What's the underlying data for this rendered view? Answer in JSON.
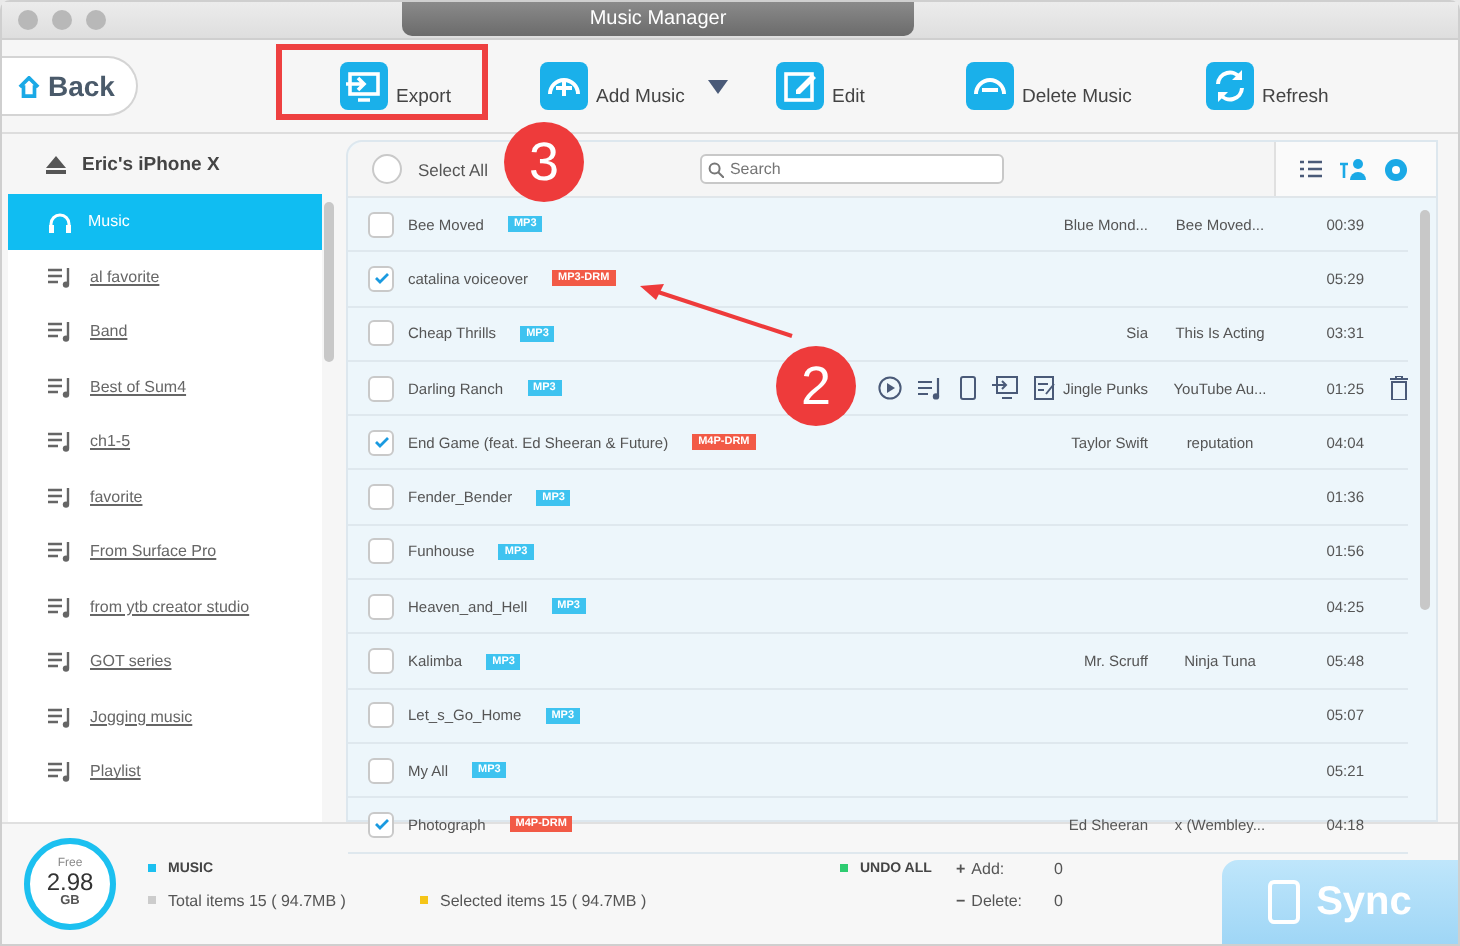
{
  "window": {
    "title": "Music Manager"
  },
  "back_button": "Back",
  "toolbar": [
    {
      "kind": "export",
      "label": "Export",
      "dropdown": false
    },
    {
      "kind": "add",
      "label": "Add Music",
      "dropdown": true
    },
    {
      "kind": "edit",
      "label": "Edit",
      "dropdown": false
    },
    {
      "kind": "delete",
      "label": "Delete Music",
      "dropdown": false
    },
    {
      "kind": "refresh",
      "label": "Refresh",
      "dropdown": false
    }
  ],
  "sidebar": {
    "device": "Eric's iPhone X",
    "items": [
      {
        "kind": "music",
        "label": "Music",
        "selected": true
      },
      {
        "kind": "playlist",
        "label": "al favorite",
        "selected": false
      },
      {
        "kind": "playlist",
        "label": "Band",
        "selected": false
      },
      {
        "kind": "playlist",
        "label": "Best of Sum4",
        "selected": false
      },
      {
        "kind": "playlist",
        "label": "ch1-5",
        "selected": false
      },
      {
        "kind": "playlist",
        "label": "favorite",
        "selected": false
      },
      {
        "kind": "playlist",
        "label": "From Surface Pro",
        "selected": false
      },
      {
        "kind": "playlist",
        "label": "from ytb creator studio",
        "selected": false
      },
      {
        "kind": "playlist",
        "label": "GOT series",
        "selected": false
      },
      {
        "kind": "playlist",
        "label": "Jogging music",
        "selected": false
      },
      {
        "kind": "playlist",
        "label": "Playlist",
        "selected": false
      }
    ]
  },
  "list_header": {
    "select_all": "Select All",
    "select_all_checked": false,
    "search_placeholder": "Search"
  },
  "tracks": [
    {
      "name": "Bee Moved",
      "tag": "MP3",
      "drm": false,
      "artist": "Blue Mond...",
      "album": "Bee Moved...",
      "time": "00:39",
      "checked": false,
      "hovered": false
    },
    {
      "name": "catalina voiceover",
      "tag": "MP3-DRM",
      "drm": true,
      "time": "05:29",
      "checked": true,
      "hovered": false
    },
    {
      "name": "Cheap Thrills",
      "tag": "MP3",
      "drm": false,
      "artist": "Sia",
      "album": "This Is Acting",
      "time": "03:31",
      "checked": false,
      "hovered": false
    },
    {
      "name": "Darling Ranch",
      "tag": "MP3",
      "drm": false,
      "artist": "Jingle Punks",
      "album": "YouTube Au...",
      "time": "01:25",
      "checked": false,
      "hovered": true
    },
    {
      "name": "End Game (feat. Ed Sheeran & Future)",
      "tag": "M4P-DRM",
      "drm": true,
      "artist": "Taylor Swift",
      "album": "reputation",
      "time": "04:04",
      "checked": true,
      "hovered": false
    },
    {
      "name": "Fender_Bender",
      "tag": "MP3",
      "drm": false,
      "time": "01:36",
      "checked": false,
      "hovered": false
    },
    {
      "name": "Funhouse",
      "tag": "MP3",
      "drm": false,
      "time": "01:56",
      "checked": false,
      "hovered": false
    },
    {
      "name": "Heaven_and_Hell",
      "tag": "MP3",
      "drm": false,
      "time": "04:25",
      "checked": false,
      "hovered": false
    },
    {
      "name": "Kalimba",
      "tag": "MP3",
      "drm": false,
      "artist": "Mr. Scruff",
      "album": "Ninja Tuna",
      "time": "05:48",
      "checked": false,
      "hovered": false
    },
    {
      "name": "Let_s_Go_Home",
      "tag": "MP3",
      "drm": false,
      "time": "05:07",
      "checked": false,
      "hovered": false
    },
    {
      "name": "My All",
      "tag": "MP3",
      "drm": false,
      "time": "05:21",
      "checked": false,
      "hovered": false
    },
    {
      "name": "Photograph",
      "tag": "M4P-DRM",
      "drm": true,
      "artist": "Ed Sheeran",
      "album": "x (Wembley...",
      "time": "04:18",
      "checked": true,
      "hovered": false
    }
  ],
  "storage": {
    "caption": "Free",
    "value": "2.98",
    "unit": "GB"
  },
  "summary": {
    "category": "MUSIC",
    "total": "Total items 15 ( 94.7MB )",
    "selected": "Selected items 15 ( 94.7MB )",
    "undo": "UNDO ALL",
    "add_sign": "+",
    "add_label": "Add:",
    "add_count": "0",
    "delete_sign": "−",
    "delete_label": "Delete:",
    "delete_count": "0"
  },
  "sync_button": "Sync",
  "callouts": [
    "3",
    "2"
  ]
}
